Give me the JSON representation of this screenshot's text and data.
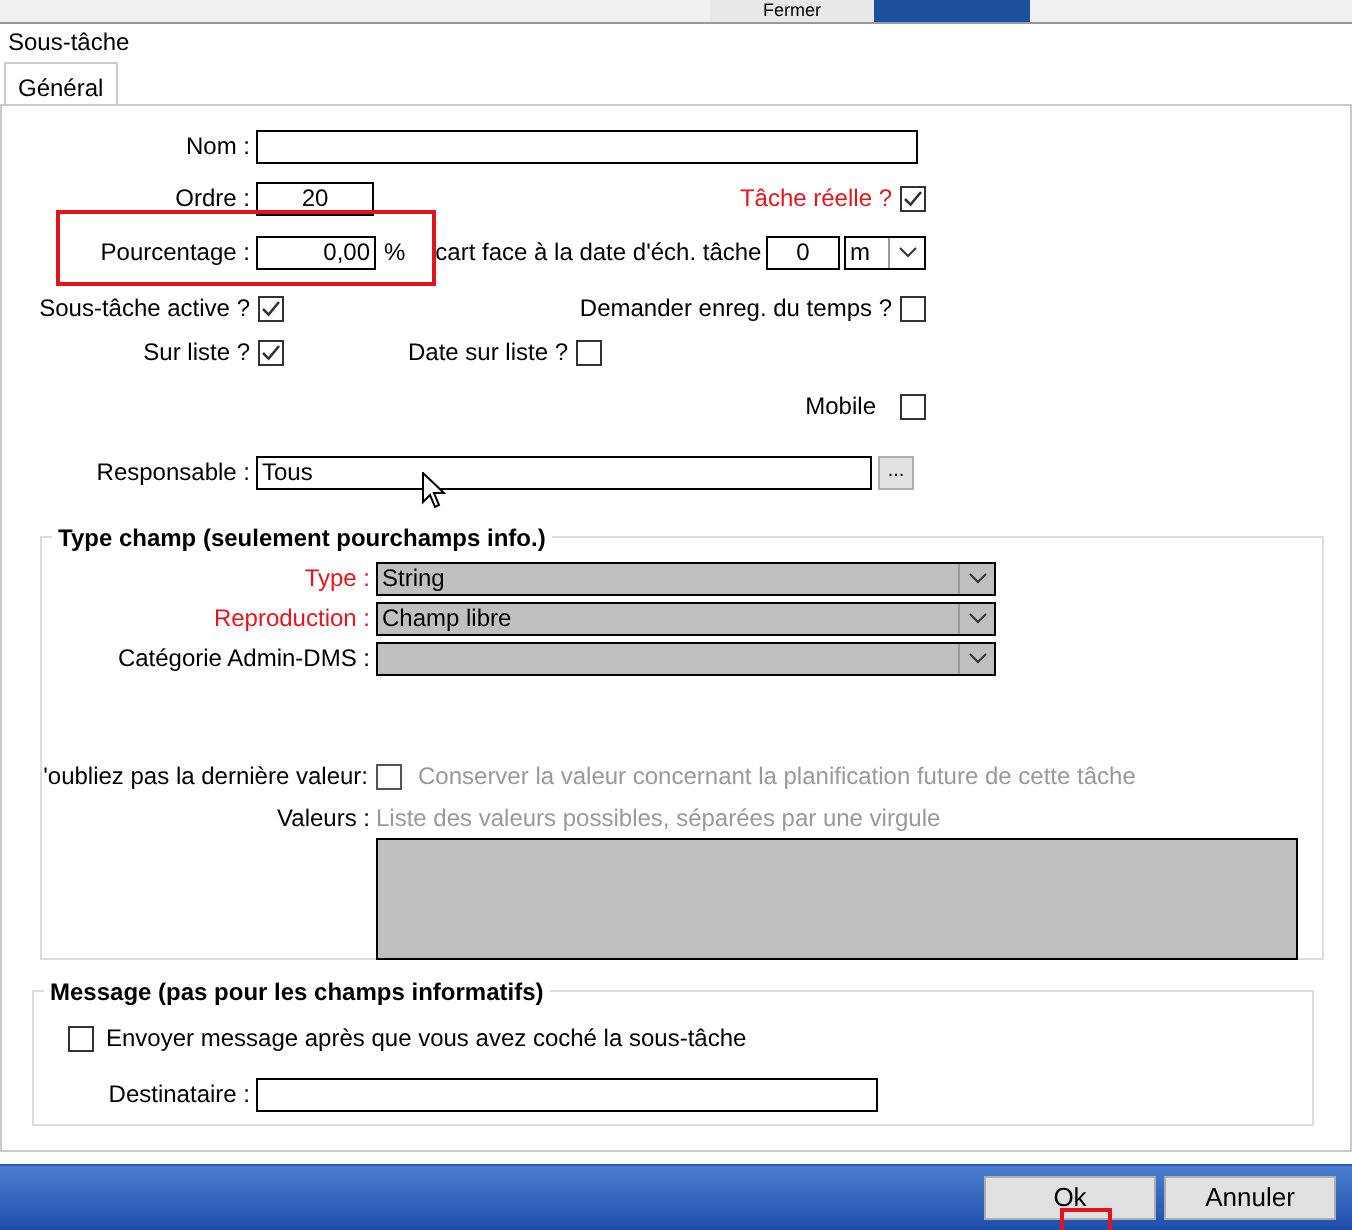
{
  "background_window": {
    "button": "Fermer"
  },
  "dialog": {
    "title": "Sous-tâche"
  },
  "tabs": [
    {
      "label": "Général",
      "selected": true
    }
  ],
  "general": {
    "nom": {
      "label": "Nom :"
    },
    "ordre": {
      "label": "Ordre :",
      "value": "20"
    },
    "tache_reelle": {
      "label": "Tâche réelle ?",
      "required": true,
      "checked": true
    },
    "pourcentage": {
      "label": "Pourcentage :",
      "value": "0,00",
      "unit": "%"
    },
    "ecart": {
      "label": "cart face à la date d'éch. tâche",
      "value": "0",
      "unit": "m"
    },
    "sous_tache_active": {
      "label": "Sous-tâche active ?",
      "checked": true
    },
    "demander_enreg": {
      "label": "Demander enreg. du temps ?",
      "checked": false
    },
    "sur_liste": {
      "label": "Sur liste ?",
      "checked": true
    },
    "date_sur_liste": {
      "label": "Date sur liste ?",
      "checked": false
    },
    "mobile": {
      "label": "Mobile",
      "checked": false
    },
    "responsable": {
      "label": "Responsable :",
      "value": "Tous",
      "button": "..."
    }
  },
  "type_champ": {
    "title": "Type champ (seulement pourchamps info.)",
    "selects": [
      {
        "label": "Type :",
        "required": true,
        "value": "String"
      },
      {
        "label": "Reproduction :",
        "required": true,
        "value": "Champ libre"
      },
      {
        "label": "Catégorie Admin-DMS :",
        "required": false
      }
    ],
    "last_value": {
      "label": "'oubliez pas la dernière valeur:",
      "checked": false,
      "disabled": true,
      "text": "Conserver la valeur concernant la planification future de cette tâche"
    },
    "valeurs": {
      "label": "Valeurs :",
      "hint": "Liste des valeurs possibles, séparées par une virgule"
    }
  },
  "message": {
    "title": "Message (pas pour les champs informatifs)",
    "send": {
      "label": "Envoyer message après que vous avez coché la sous-tâche",
      "checked": false
    },
    "destinataire": {
      "label": "Destinataire :"
    }
  },
  "buttons": [
    "Ok",
    "Annuler"
  ]
}
